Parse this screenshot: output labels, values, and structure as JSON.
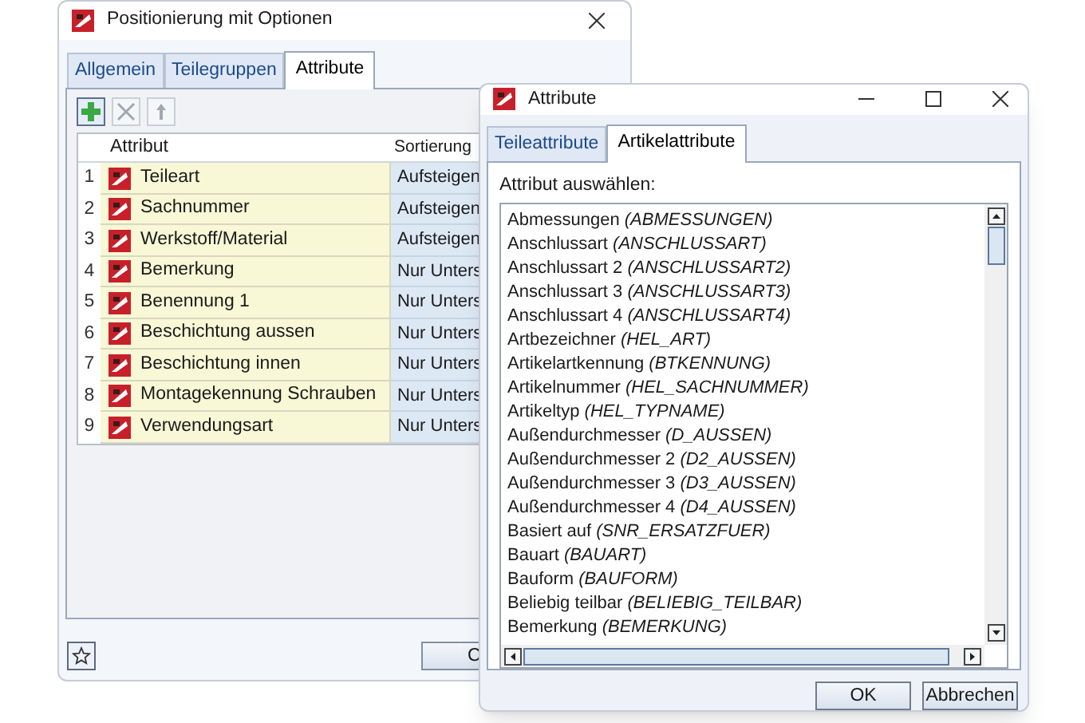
{
  "main_window": {
    "title": "Positionierung mit Optionen",
    "tabs": [
      {
        "label": "Allgemein",
        "selected": false
      },
      {
        "label": "Teilegruppen",
        "selected": false
      },
      {
        "label": "Attribute",
        "selected": true
      }
    ],
    "toolbar": [
      {
        "kind": "add",
        "disabled": false
      },
      {
        "kind": "delete",
        "disabled": true
      },
      {
        "kind": "up",
        "disabled": true
      }
    ],
    "table": {
      "columns": [
        "Attribut",
        "Sortierung"
      ],
      "rows": [
        {
          "number": "1",
          "attribute": "Teileart",
          "sorting": "Aufsteigen"
        },
        {
          "number": "2",
          "attribute": "Sachnummer",
          "sorting": "Aufsteigen"
        },
        {
          "number": "3",
          "attribute": "Werkstoff/Material",
          "sorting": "Aufsteigen"
        },
        {
          "number": "4",
          "attribute": "Bemerkung",
          "sorting": "Nur Unters"
        },
        {
          "number": "5",
          "attribute": "Benennung 1",
          "sorting": "Nur Unters"
        },
        {
          "number": "6",
          "attribute": "Beschichtung aussen",
          "sorting": "Nur Unters"
        },
        {
          "number": "7",
          "attribute": "Beschichtung innen",
          "sorting": "Nur Unters"
        },
        {
          "number": "8",
          "attribute": "Montagekennung Schrauben",
          "sorting": "Nur Unters"
        },
        {
          "number": "9",
          "attribute": "Verwendungsart",
          "sorting": "Nur Unters"
        }
      ]
    },
    "buttons": [
      "C"
    ]
  },
  "dialog": {
    "title": "Attribute",
    "tabs": [
      {
        "label": "Teileattribute",
        "selected": false
      },
      {
        "label": "Artikelattribute",
        "selected": true
      }
    ],
    "label": "Attribut auswählen:",
    "items": [
      "Abmessungen *(ABMESSUNGEN)*",
      "Anschlussart *(ANSCHLUSSART)*",
      "Anschlussart 2 *(ANSCHLUSSART2)*",
      "Anschlussart 3 *(ANSCHLUSSART3)*",
      "Anschlussart 4 *(ANSCHLUSSART4)*",
      "Artbezeichner *(HEL_ART)*",
      "Artikelartkennung *(BTKENNUNG)*",
      "Artikelnummer *(HEL_SACHNUMMER)*",
      "Artikeltyp *(HEL_TYPNAME)*",
      "Außendurchmesser *(D_AUSSEN)*",
      "Außendurchmesser 2 *(D2_AUSSEN)*",
      "Außendurchmesser 3 *(D3_AUSSEN)*",
      "Außendurchmesser 4 *(D4_AUSSEN)*",
      "Basiert auf *(SNR_ERSATZFUER)*",
      "Bauart *(BAUART)*",
      "Bauform *(BAUFORM)*",
      "Beliebig teilbar *(BELIEBIG_TEILBAR)*",
      "Bemerkung *(BEMERKUNG)*"
    ],
    "buttons": [
      "OK",
      "Abbrechen"
    ]
  }
}
